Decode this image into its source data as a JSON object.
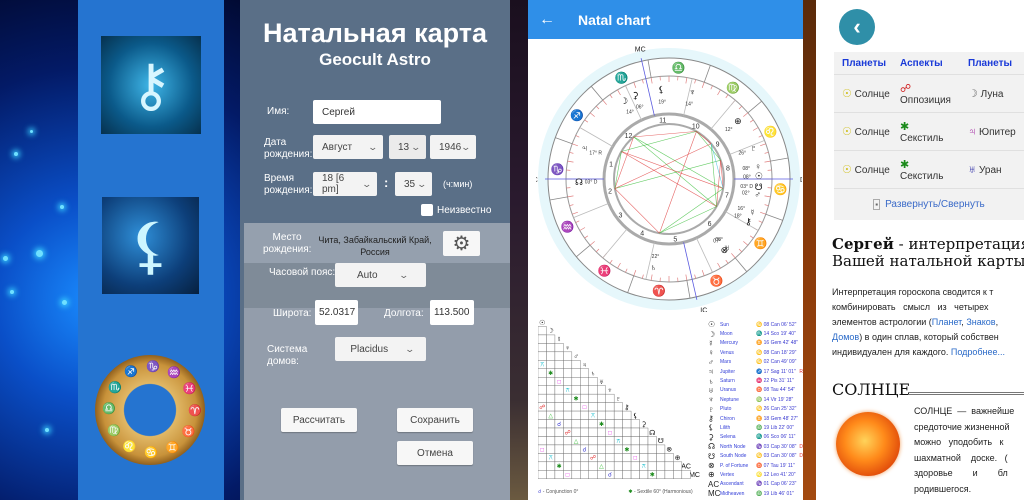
{
  "panel_promo": {
    "icons": [
      {
        "name": "chiron-zodiac-wheel-icon",
        "glyph": "⚷"
      },
      {
        "name": "lilith-moon-icon",
        "glyph": "⚸"
      },
      {
        "name": "golden-zodiac-ring-icon",
        "glyphs": [
          "♐",
          "♑",
          "♒",
          "♓",
          "♈",
          "♉",
          "♊",
          "♋",
          "♌",
          "♍",
          "♎",
          "♏"
        ]
      }
    ]
  },
  "form": {
    "title": "Натальная карта",
    "subtitle": "Geocult Astro",
    "name_label": "Имя:",
    "name_value": "Сергей",
    "date_label": "Дата рождения:",
    "date_month": "Август",
    "date_day": "13",
    "date_year": "1946",
    "time_label": "Время рождения:",
    "time_hour": "18 [6 pm]",
    "time_sep": ":",
    "time_minute": "35",
    "time_format": "(ч:мин)",
    "unknown_label": "Неизвестно",
    "unknown_checked": false,
    "place_label": "Место рождения:",
    "place_value": "Чита, Забайкальский Край, Россия",
    "timezone_label": "Часовой пояс:",
    "timezone_value": "Auto",
    "lat_label": "Широта:",
    "lat_value": "52.0317",
    "lon_label": "Долгота:",
    "lon_value": "113.500",
    "house_label": "Система домов:",
    "house_value": "Placidus",
    "calc_button": "Рассчитать",
    "save_button": "Сохранить",
    "cancel_button": "Отмена"
  },
  "natal": {
    "appbar_title": "Natal chart",
    "back_icon": "←",
    "angles": {
      "mc": "MC",
      "ac": "AC",
      "dc": "DC",
      "ic": "IC"
    },
    "house_numbers": [
      "1",
      "2",
      "3",
      "4",
      "5",
      "6",
      "7",
      "8",
      "9",
      "10",
      "11",
      "12"
    ],
    "sign_ring": [
      {
        "glyph": "♎",
        "color": "#f08040"
      },
      {
        "glyph": "♍",
        "color": "#2a9a2a"
      },
      {
        "glyph": "♌",
        "color": "#e02020"
      },
      {
        "glyph": "♋",
        "color": "#2030d0"
      },
      {
        "glyph": "♊",
        "color": "#f08040"
      },
      {
        "glyph": "♉",
        "color": "#2a9a2a"
      },
      {
        "glyph": "♈",
        "color": "#e02020"
      },
      {
        "glyph": "♓",
        "color": "#2030d0"
      },
      {
        "glyph": "♒",
        "color": "#f08040"
      },
      {
        "glyph": "♑",
        "color": "#2a9a2a"
      },
      {
        "glyph": "♐",
        "color": "#e02020"
      },
      {
        "glyph": "♏",
        "color": "#2030d0"
      }
    ],
    "wheel_planets": [
      {
        "glyph": "⚸",
        "deg": "19°"
      },
      {
        "glyph": "♆",
        "deg": "14°"
      },
      {
        "glyph": "☽",
        "deg": "14°"
      },
      {
        "glyph": "⚳",
        "deg": "06°"
      },
      {
        "glyph": "♃",
        "deg": "17°",
        "retro": "R"
      },
      {
        "glyph": "☊",
        "deg": "03°",
        "flag": "D"
      },
      {
        "glyph": "⊕",
        "deg": "12°"
      },
      {
        "glyph": "♇",
        "deg": "26°"
      },
      {
        "glyph": "♀",
        "deg": "08°"
      },
      {
        "glyph": "☉",
        "deg": "08°"
      },
      {
        "glyph": "☋",
        "deg": "03°",
        "flag": "D"
      },
      {
        "glyph": "♂",
        "deg": "02°"
      },
      {
        "glyph": "☿",
        "deg": "16°"
      },
      {
        "glyph": "⚷",
        "deg": "18°"
      },
      {
        "glyph": "♅",
        "deg": "08°"
      },
      {
        "glyph": "⊗",
        "deg": "07°"
      },
      {
        "glyph": "♄",
        "deg": "22°"
      }
    ],
    "grid_glyphs": [
      "☉",
      "☽",
      "☿",
      "♀",
      "♂",
      "♃",
      "♄",
      "♅",
      "♆",
      "♇",
      "⚷",
      "⚸",
      "⚳",
      "☊",
      "☋",
      "⊗",
      "⊕",
      "AC",
      "MC"
    ],
    "planets": [
      {
        "glyph": "☉",
        "name": "Sun",
        "position": "♋ 08 Can 06' 52\"",
        "flag": ""
      },
      {
        "glyph": "☽",
        "name": "Moon",
        "position": "♏ 14 Sco 19' 40\"",
        "flag": ""
      },
      {
        "glyph": "☿",
        "name": "Mercury",
        "position": "♊ 16 Gem 42' 48\"",
        "flag": ""
      },
      {
        "glyph": "♀",
        "name": "Venus",
        "position": "♋ 08 Can 18' 29\"",
        "flag": ""
      },
      {
        "glyph": "♂",
        "name": "Mars",
        "position": "♋ 02 Can 49' 09\"",
        "flag": ""
      },
      {
        "glyph": "♃",
        "name": "Jupiter",
        "position": "♐ 17 Sag 11' 01\"",
        "flag": "R"
      },
      {
        "glyph": "♄",
        "name": "Saturn",
        "position": "♓ 22 Pis 31' 11\"",
        "flag": ""
      },
      {
        "glyph": "♅",
        "name": "Uranus",
        "position": "♉ 08 Tau 44' 54\"",
        "flag": ""
      },
      {
        "glyph": "♆",
        "name": "Neptune",
        "position": "♍ 14 Vir 19' 28\"",
        "flag": ""
      },
      {
        "glyph": "♇",
        "name": "Pluto",
        "position": "♋ 26 Can 25' 32\"",
        "flag": ""
      },
      {
        "glyph": "⚷",
        "name": "Chiron",
        "position": "♊ 18 Gem 48' 27\"",
        "flag": ""
      },
      {
        "glyph": "⚸",
        "name": "Lilith",
        "position": "♎ 19 Lib 22' 00\"",
        "flag": ""
      },
      {
        "glyph": "⚳",
        "name": "Selena",
        "position": "♏ 06 Sco 06' 11\"",
        "flag": ""
      },
      {
        "glyph": "☊",
        "name": "North Node",
        "position": "♑ 03 Cap 30' 08\"",
        "flag": "D"
      },
      {
        "glyph": "☋",
        "name": "South Node",
        "position": "♋ 03 Can 30' 08\"",
        "flag": "D"
      },
      {
        "glyph": "⊗",
        "name": "P. of Fortune",
        "position": "♉ 07 Tau 19' 11\"",
        "flag": ""
      },
      {
        "glyph": "⊕",
        "name": "Vertex",
        "position": "♌ 12 Leo 41' 20\"",
        "flag": ""
      },
      {
        "glyph": "AC",
        "name": "Ascendant",
        "position": "♑ 01 Cap 06' 23\"",
        "flag": ""
      },
      {
        "glyph": "MC",
        "name": "Midheaven",
        "position": "♎ 19 Lib 46' 01\"",
        "flag": ""
      }
    ],
    "legend": [
      {
        "glyph": "☌",
        "label": "- Conjunction 0°",
        "color": "#3a3ad0"
      },
      {
        "glyph": "✱",
        "label": "- Sextile 60° (Harmonious)",
        "color": "#1a8a1a"
      }
    ]
  },
  "interpretation": {
    "back_icon": "‹",
    "table_headers": [
      "Планеты",
      "Аспекты",
      "Планеты"
    ],
    "rows": [
      {
        "p1": "Солнце",
        "p1_glyph": "☉",
        "aspect": "Оппозиция",
        "aspect_glyph": "☍",
        "aspect_color": "#d02020",
        "p2": "Луна",
        "p2_glyph": "☽",
        "p2_color": "#666666"
      },
      {
        "p1": "Солнце",
        "p1_glyph": "☉",
        "aspect": "Секстиль",
        "aspect_glyph": "✱",
        "aspect_color": "#1a8a1a",
        "p2": "Юпитер",
        "p2_glyph": "♃",
        "p2_color": "#a020a0"
      },
      {
        "p1": "Солнце",
        "p1_glyph": "☉",
        "aspect": "Секстиль",
        "aspect_glyph": "✱",
        "aspect_color": "#1a8a1a",
        "p2": "Уран",
        "p2_glyph": "♅",
        "p2_color": "#2020a0"
      }
    ],
    "expand_label": "Развернуть/Свернуть",
    "heading_bold": "Сергей",
    "heading_rest": " - интерпретация",
    "heading_line2": "Вашей натальной карты",
    "para_1": "Интерпретация гороскопа сводится к т",
    "para_2": "комбинировать   смысл   из   четырех",
    "para_3a": "элементов астрологии (",
    "link_planets": "Планет",
    "para_3b": ", ",
    "link_signs": "Знаков",
    "para_3c": ",",
    "link_houses": "Домов",
    "para_4": ") в один сплав, который собствен",
    "para_5": "индивидуален для каждого. ",
    "link_more": "Подробнее...",
    "sun_heading": "СОЛНЦЕ",
    "sun_lines": [
      "СОЛНЦЕ  —  важнейше",
      "средоточие жизненной",
      "можно   уподобить   к",
      "шахматной    доске.   (",
      "здоровье        и        бл",
      "родившегося."
    ]
  }
}
